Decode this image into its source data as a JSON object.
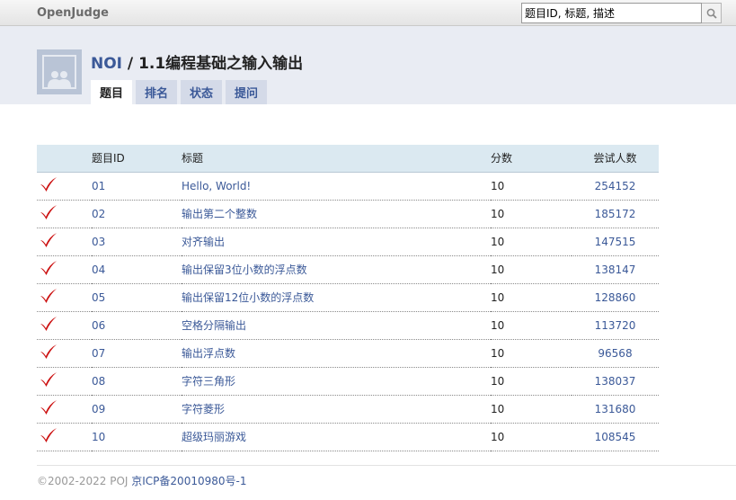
{
  "topbar": {
    "brand": "OpenJudge",
    "search": {
      "value": "题目ID, 标题, 描述"
    }
  },
  "header": {
    "group": "NOI",
    "separator": " / ",
    "course": "1.1编程基础之输入输出",
    "tabs": [
      {
        "label": "题目",
        "active": true
      },
      {
        "label": "排名",
        "active": false
      },
      {
        "label": "状态",
        "active": false
      },
      {
        "label": "提问",
        "active": false
      }
    ]
  },
  "table": {
    "headers": {
      "id": "题目ID",
      "title": "标题",
      "score": "分数",
      "tries": "尝试人数"
    },
    "rows": [
      {
        "id": "01",
        "title": "Hello, World!",
        "score": "10",
        "tries": "254152"
      },
      {
        "id": "02",
        "title": "输出第二个整数",
        "score": "10",
        "tries": "185172"
      },
      {
        "id": "03",
        "title": "对齐输出",
        "score": "10",
        "tries": "147515"
      },
      {
        "id": "04",
        "title": "输出保留3位小数的浮点数",
        "score": "10",
        "tries": "138147"
      },
      {
        "id": "05",
        "title": "输出保留12位小数的浮点数",
        "score": "10",
        "tries": "128860"
      },
      {
        "id": "06",
        "title": "空格分隔输出",
        "score": "10",
        "tries": "113720"
      },
      {
        "id": "07",
        "title": "输出浮点数",
        "score": "10",
        "tries": "96568"
      },
      {
        "id": "08",
        "title": "字符三角形",
        "score": "10",
        "tries": "138037"
      },
      {
        "id": "09",
        "title": "字符菱形",
        "score": "10",
        "tries": "131680"
      },
      {
        "id": "10",
        "title": "超级玛丽游戏",
        "score": "10",
        "tries": "108545"
      }
    ]
  },
  "footer": {
    "copyright": "©2002-2022 POJ ",
    "icp": "京ICP备20010980号-1"
  },
  "colors": {
    "link": "#3b5998",
    "check": "#cc1111",
    "header_bg": "#e9ecf3",
    "table_head_bg": "#dbe9f1"
  },
  "icons": {
    "search": "magnifier-icon",
    "solved": "checkmark-icon",
    "avatar": "group-avatar-icon"
  }
}
